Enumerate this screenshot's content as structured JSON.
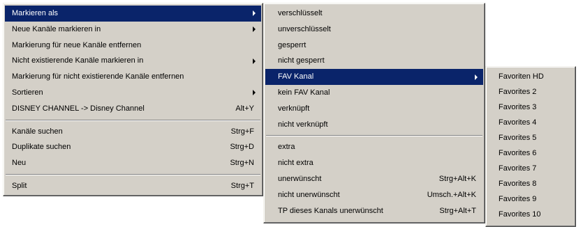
{
  "menu1": {
    "items": [
      {
        "label": "Markieren als",
        "shortcut": ""
      },
      {
        "label": "Neue Kanäle markieren in",
        "shortcut": ""
      },
      {
        "label": "Markierung für neue Kanäle entfernen",
        "shortcut": ""
      },
      {
        "label": "Nicht existierende Kanäle markieren in",
        "shortcut": ""
      },
      {
        "label": "Markierung für nicht existierende Kanäle entfernen",
        "shortcut": ""
      },
      {
        "label": "Sortieren",
        "shortcut": ""
      },
      {
        "label": "DISNEY CHANNEL -> Disney Channel",
        "shortcut": "Alt+Y"
      },
      {
        "label": "Kanäle suchen",
        "shortcut": "Strg+F"
      },
      {
        "label": "Duplikate suchen",
        "shortcut": "Strg+D"
      },
      {
        "label": "Neu",
        "shortcut": "Strg+N"
      },
      {
        "label": "Split",
        "shortcut": "Strg+T"
      }
    ]
  },
  "menu2": {
    "items": [
      {
        "label": "verschlüsselt",
        "shortcut": ""
      },
      {
        "label": "unverschlüsselt",
        "shortcut": ""
      },
      {
        "label": "gesperrt",
        "shortcut": ""
      },
      {
        "label": "nicht gesperrt",
        "shortcut": ""
      },
      {
        "label": "FAV Kanal",
        "shortcut": ""
      },
      {
        "label": "kein FAV Kanal",
        "shortcut": ""
      },
      {
        "label": "verknüpft",
        "shortcut": ""
      },
      {
        "label": "nicht verknüpft",
        "shortcut": ""
      },
      {
        "label": "extra",
        "shortcut": ""
      },
      {
        "label": "nicht extra",
        "shortcut": ""
      },
      {
        "label": "unerwünscht",
        "shortcut": "Strg+Alt+K"
      },
      {
        "label": "nicht unerwünscht",
        "shortcut": "Umsch.+Alt+K"
      },
      {
        "label": "TP dieses Kanals unerwünscht",
        "shortcut": "Strg+Alt+T"
      }
    ]
  },
  "menu3": {
    "items": [
      {
        "label": "Favoriten HD"
      },
      {
        "label": "Favorites 2"
      },
      {
        "label": "Favorites 3"
      },
      {
        "label": "Favorites 4"
      },
      {
        "label": "Favorites 5"
      },
      {
        "label": "Favorites 6"
      },
      {
        "label": "Favorites 7"
      },
      {
        "label": "Favorites 8"
      },
      {
        "label": "Favorites 9"
      },
      {
        "label": "Favorites 10"
      }
    ]
  },
  "colors": {
    "menu_background": "#d4d0c8",
    "highlight": "#0a246a",
    "highlight_text": "#ffffff"
  }
}
